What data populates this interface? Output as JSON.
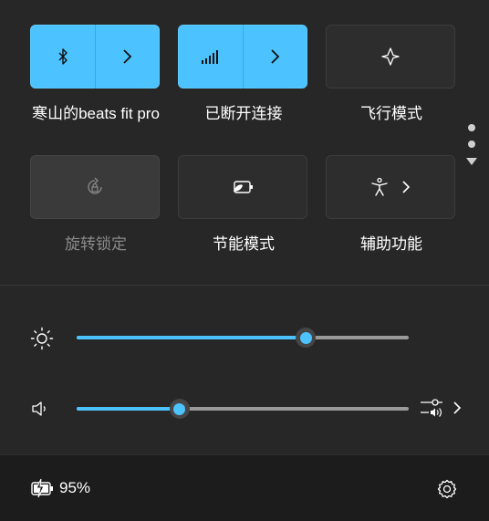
{
  "tiles": [
    {
      "label": "寒山的beats fit pro",
      "state": "on",
      "icon": "bluetooth-icon",
      "has_expand": true
    },
    {
      "label": "已断开连接",
      "state": "on",
      "icon": "cellular-signal-icon",
      "has_expand": true
    },
    {
      "label": "飞行模式",
      "state": "off",
      "icon": "airplane-icon",
      "has_expand": false
    },
    {
      "label": "旋转锁定",
      "state": "disabled",
      "icon": "rotation-lock-icon",
      "has_expand": false
    },
    {
      "label": "节能模式",
      "state": "off",
      "icon": "battery-saver-icon",
      "has_expand": false
    },
    {
      "label": "辅助功能",
      "state": "off",
      "icon": "accessibility-icon",
      "has_expand": true
    }
  ],
  "brightness": {
    "icon": "sun-icon",
    "level_percent": 69
  },
  "volume": {
    "icon": "speaker-icon",
    "level_percent": 31,
    "mixer_icon": "audio-mixer-icon"
  },
  "battery": {
    "icon": "battery-charging-icon",
    "percent_label": "95%"
  },
  "settings": {
    "icon": "gear-icon"
  },
  "pager": {
    "pages": 2,
    "current": 0
  },
  "colors": {
    "accent": "#4cc2ff",
    "panel": "#272727",
    "tile_off": "#2d2d2d"
  }
}
